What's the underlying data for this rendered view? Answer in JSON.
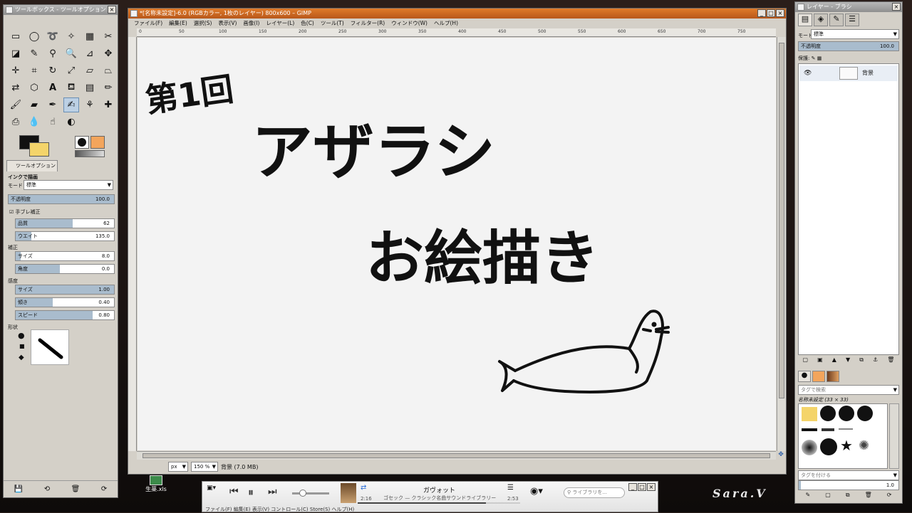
{
  "toolbox": {
    "title": "ツールボックス - ツールオプション",
    "options_tab": "ツールオプション",
    "tool_heading": "インクで描画",
    "mode_label": "モード",
    "mode_value": "標準",
    "opacity_label": "不透明度",
    "opacity_value": "100.0",
    "antishake_label": "手ブレ補正",
    "quality_label": "品質",
    "quality_value": "62",
    "weight_label": "ウエイト",
    "weight_value": "135.0",
    "adjust_label": "補正",
    "size_label": "サイズ",
    "size_value": "8.0",
    "angle_label": "角度",
    "angle_value": "0.0",
    "sensitivity_label": "感度",
    "sens_size_label": "サイズ",
    "sens_size_value": "1.00",
    "tilt_label": "傾き",
    "tilt_value": "0.40",
    "speed_label": "スピード",
    "speed_value": "0.80",
    "shape_label": "形状"
  },
  "image_window": {
    "title": "*[名称未設定]-6.0 (RGBカラー, 1枚のレイヤー) 800x600 – GIMP",
    "menu": [
      "ファイル(F)",
      "編集(E)",
      "選択(S)",
      "表示(V)",
      "画像(I)",
      "レイヤー(L)",
      "色(C)",
      "ツール(T)",
      "フィルター(R)",
      "ウィンドウ(W)",
      "ヘルプ(H)"
    ],
    "ruler_ticks": [
      "0",
      "50",
      "100",
      "150",
      "200",
      "250",
      "300",
      "350",
      "400",
      "450",
      "500",
      "550",
      "600",
      "650",
      "700",
      "750"
    ],
    "unit": "px",
    "zoom": "150 %",
    "status": "背景 (7.0 MB)"
  },
  "artwork": {
    "line1": "第1回",
    "line2": "アザラシ",
    "line3": "お絵描き"
  },
  "layers": {
    "title": "レイヤー - ブラシ",
    "mode_label": "モード",
    "mode_value": "標準",
    "opacity_label": "不透明度",
    "opacity_value": "100.0",
    "lock_label": "保護:",
    "layer_name": "背景",
    "tag_filter": "タグで検索",
    "brush_name": "名称未設定 (33 × 33)",
    "tag_assign": "タグを付ける",
    "spacing_value": "1.0"
  },
  "player": {
    "track": "ガヴォット",
    "artist": "ゴセック — クラシック名曲サウンドライブラリー",
    "elapsed": "2:16",
    "total": "2:53",
    "search_placeholder": "ライブラリを...",
    "menu": "ファイル(F)  編集(E)  表示(V)  コントロール(C)  Store(S)  ヘルプ(H)"
  },
  "desktop": {
    "file_label": "生薬.xls",
    "watermark": "Sara.V"
  }
}
